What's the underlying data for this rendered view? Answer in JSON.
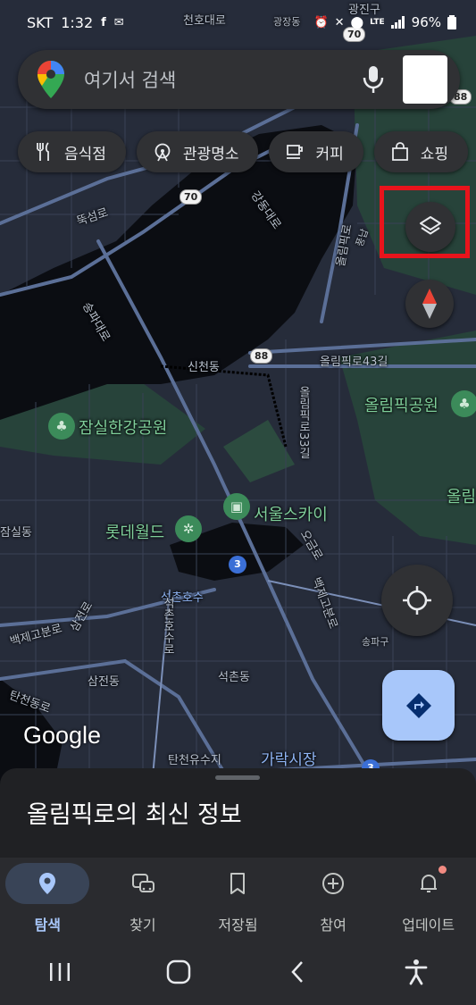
{
  "status_bar": {
    "carrier": "SKT",
    "time": "1:32",
    "left_icons": [
      "facebook-icon",
      "messenger-icon"
    ],
    "right_icons": [
      "alarm-icon",
      "mute-icon",
      "location-icon",
      "network-icon",
      "signal-icon",
      "battery-icon"
    ],
    "network": "LTE",
    "battery": "96%"
  },
  "search": {
    "placeholder": "여기서 검색",
    "left_icon": "google-maps-pin-icon",
    "right_icon": "microphone-icon"
  },
  "chips": [
    {
      "label": "음식점",
      "icon": "restaurant-icon"
    },
    {
      "label": "관광명소",
      "icon": "attraction-icon"
    },
    {
      "label": "커피",
      "icon": "coffee-icon"
    },
    {
      "label": "쇼핑",
      "icon": "shopping-bag-icon"
    }
  ],
  "map": {
    "labels": {
      "cheonho": "천호대로",
      "gwangjang": "광장동",
      "ttukseom": "뚝섬로",
      "gangdong": "강동대로",
      "songpa": "송파대로",
      "sincheon": "신천동",
      "olympic43": "올림픽로43길",
      "olympic33": "올림픽로33길",
      "jamsil_park": "잠실한강공원",
      "olympic_park": "올림픽공원",
      "olympic_park2": "올림",
      "lotte": "롯데월드",
      "seoul_sky": "서울스카이",
      "jamsil_dong": "잠실동",
      "seokchon_lake": "석촌호수",
      "ogeum": "오금로",
      "baekjegobun": "백제고분로",
      "baekjegobun2": "백제고분로",
      "samjeon": "삼전로",
      "seokchon_lake_road": "석촌호수로",
      "songpa_dong": "송파구",
      "samjeon_dong": "삼전동",
      "seokchon_dong": "석촌동",
      "tancheon": "탄천동로",
      "tancheon_park": "탄천유수지",
      "garak_market": "가락시장",
      "olympic_ro": "올림픽로",
      "route70a": "70",
      "route70b": "70",
      "route88": "88",
      "route88b": "88",
      "line3": "3",
      "line3b": "3",
      "region_top": "광진구",
      "region_right": "풍납"
    },
    "logo": "Google"
  },
  "buttons": {
    "layers": "layers-icon",
    "compass": "compass-icon",
    "my_location": "my-location-icon",
    "directions": "directions-icon"
  },
  "sheet": {
    "title": "올림픽로의 최신 정보"
  },
  "bottom_nav": [
    {
      "label": "탐색",
      "icon": "explore-pin-icon",
      "active": true
    },
    {
      "label": "찾기",
      "icon": "commute-icon",
      "active": false
    },
    {
      "label": "저장됨",
      "icon": "bookmark-icon",
      "active": false
    },
    {
      "label": "참여",
      "icon": "add-circle-icon",
      "active": false
    },
    {
      "label": "업데이트",
      "icon": "bell-icon",
      "active": false
    }
  ],
  "system_nav": [
    "recent-apps-icon",
    "home-icon",
    "back-icon",
    "accessibility-icon"
  ],
  "colors": {
    "accent": "#a8c7fa",
    "highlight": "#e8141c",
    "surface": "#303134",
    "map_water": "#0b0d12",
    "map_park": "#27433a"
  }
}
